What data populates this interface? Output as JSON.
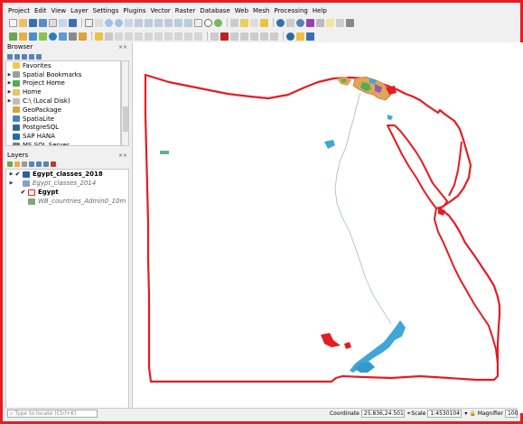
{
  "menu": [
    "Project",
    "Edit",
    "View",
    "Layer",
    "Settings",
    "Plugins",
    "Vector",
    "Raster",
    "Database",
    "Web",
    "Mesh",
    "Processing",
    "Help"
  ],
  "browser": {
    "title": "Browser",
    "close": "××",
    "items": [
      {
        "label": "Favorites",
        "icon": "star-icon",
        "color": "#f2c94c",
        "arrow": ""
      },
      {
        "label": "Spatial Bookmarks",
        "icon": "bookmark-icon",
        "color": "#9b9b9b",
        "arrow": "▶"
      },
      {
        "label": "Project Home",
        "icon": "folder-icon",
        "color": "#4caf50",
        "arrow": "▶"
      },
      {
        "label": "Home",
        "icon": "folder-icon",
        "color": "#e8c16a",
        "arrow": "▶"
      },
      {
        "label": "C:\\ (Local Disk)",
        "icon": "drive-icon",
        "color": "#bdbdbd",
        "arrow": "▶"
      },
      {
        "label": "GeoPackage",
        "icon": "geopackage-icon",
        "color": "#d7a33b",
        "arrow": ""
      },
      {
        "label": "SpatiaLite",
        "icon": "feather-icon",
        "color": "#4a7fc1",
        "arrow": ""
      },
      {
        "label": "PostgreSQL",
        "icon": "elephant-icon",
        "color": "#336791",
        "arrow": ""
      },
      {
        "label": "SAP HANA",
        "icon": "database-icon",
        "color": "#1a6fb5",
        "arrow": ""
      },
      {
        "label": "MS SQL Server",
        "icon": "database-icon",
        "color": "#7b7b7b",
        "arrow": ""
      }
    ]
  },
  "layers": {
    "title": "Layers",
    "close": "××",
    "items": [
      {
        "label": "Egypt_classes_2018",
        "checked": "✔",
        "arrow": "▶",
        "style": "l-bold",
        "icon": "raster-layer-icon",
        "color": "#2b5fa8"
      },
      {
        "label": "Egypt_classes_2014",
        "checked": "",
        "arrow": "▶",
        "style": "l-italic",
        "icon": "raster-layer-icon",
        "color": "#8a9fc4"
      },
      {
        "label": "Egypt",
        "checked": "✔",
        "arrow": "",
        "style": "l-bold",
        "icon": "polygon-symbol-icon",
        "color": "#e51c23"
      },
      {
        "label": "WB_countries_Admin0_10m",
        "checked": "",
        "arrow": "",
        "style": "l-italic",
        "icon": "polygon-symbol-icon",
        "color": "#7fa870"
      }
    ]
  },
  "status": {
    "locator_placeholder": "Type to locate (Ctrl+K)",
    "coordinate_label": "Coordinate",
    "coordinate_value": "25.836,24.501",
    "scale_label": "Scale",
    "scale_value": "1:4530104",
    "magnifier_label": "Magnifier",
    "magnifier_value": "100"
  },
  "colors": {
    "boundary": "#e51c23",
    "water": "#41a6d6",
    "accent": "#e51c23"
  }
}
